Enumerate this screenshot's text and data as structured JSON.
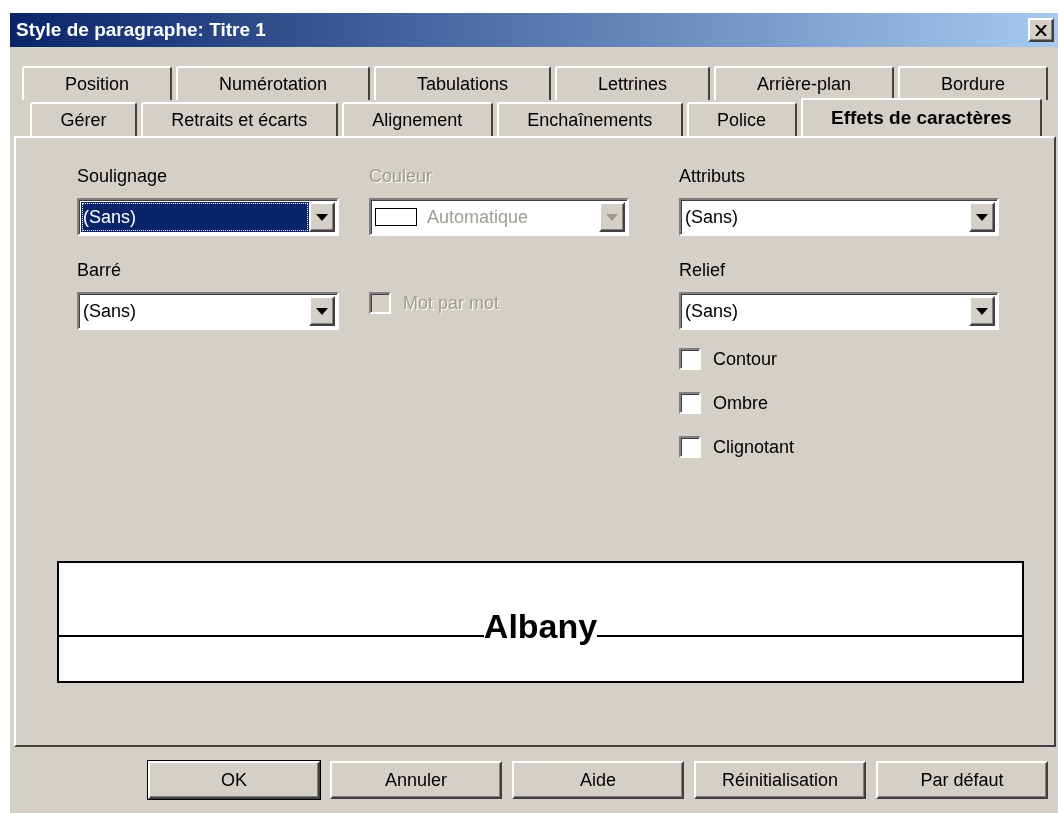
{
  "window": {
    "title": "Style de paragraphe: Titre 1"
  },
  "tab_rows": [
    [
      {
        "label": "Position",
        "selected": false
      },
      {
        "label": "Numérotation",
        "selected": false
      },
      {
        "label": "Tabulations",
        "selected": false
      },
      {
        "label": "Lettrines",
        "selected": false
      },
      {
        "label": "Arrière-plan",
        "selected": false
      },
      {
        "label": "Bordure",
        "selected": false
      }
    ],
    [
      {
        "label": "Gérer",
        "selected": false
      },
      {
        "label": "Retraits et écarts",
        "selected": false
      },
      {
        "label": "Alignement",
        "selected": false
      },
      {
        "label": "Enchaînements",
        "selected": false
      },
      {
        "label": "Police",
        "selected": false
      },
      {
        "label": "Effets de caractères",
        "selected": true
      }
    ]
  ],
  "columns": [
    [
      {
        "kind": "combo",
        "label": "Soulignage",
        "value": "(Sans)",
        "focused": true,
        "disabled": false
      },
      {
        "kind": "combo",
        "label": "Barré",
        "value": "(Sans)",
        "focused": false,
        "disabled": false
      }
    ],
    [
      {
        "kind": "color_combo",
        "label": "Couleur",
        "value": "Automatique",
        "focused": false,
        "disabled": true
      },
      {
        "kind": "checkbox",
        "label": "Mot par mot",
        "checked": false,
        "disabled": true
      }
    ],
    [
      {
        "kind": "combo",
        "label": "Attributs",
        "value": "(Sans)",
        "focused": false,
        "disabled": false
      },
      {
        "kind": "combo",
        "label": "Relief",
        "value": "(Sans)",
        "focused": false,
        "disabled": false
      },
      {
        "kind": "checkbox",
        "label": "Contour",
        "checked": false,
        "disabled": false
      },
      {
        "kind": "checkbox",
        "label": "Ombre",
        "checked": false,
        "disabled": false
      },
      {
        "kind": "checkbox",
        "label": "Clignotant",
        "checked": false,
        "disabled": false
      }
    ]
  ],
  "preview": {
    "sample": "Albany"
  },
  "buttons": [
    {
      "label": "OK",
      "default": true
    },
    {
      "label": "Annuler",
      "default": false
    },
    {
      "label": "Aide",
      "default": false
    },
    {
      "label": "Réinitialisation",
      "default": false
    },
    {
      "label": "Par défaut",
      "default": false
    }
  ]
}
